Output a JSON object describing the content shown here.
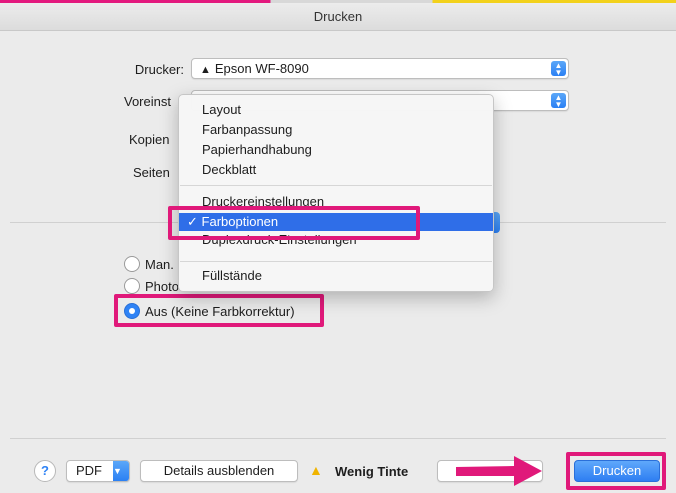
{
  "window": {
    "title": "Drucken"
  },
  "printer": {
    "label": "Drucker:",
    "value": "Epson WF-8090",
    "warning_icon": "warning-triangle-icon"
  },
  "presets": {
    "label_partial": "Voreinst"
  },
  "copies": {
    "label_partial": "Kopien"
  },
  "pages": {
    "label_partial": "Seiten"
  },
  "menu": {
    "items": [
      {
        "label": "Layout"
      },
      {
        "label": "Farbanpassung"
      },
      {
        "label": "Papierhandhabung"
      },
      {
        "label": "Deckblatt"
      },
      {
        "label": "Druckereinstellungen"
      },
      {
        "label": "Farboptionen",
        "checked": true,
        "check_glyph": "✓"
      },
      {
        "label": "Duplexdruck-Einstellungen"
      },
      {
        "label": "Füllstände"
      }
    ]
  },
  "color_options": {
    "radios": [
      {
        "label": "Man.",
        "selected": false
      },
      {
        "label": "Photo",
        "selected": false
      },
      {
        "label": "Aus (Keine Farbkorrektur)",
        "selected": true
      }
    ]
  },
  "footer": {
    "help": "?",
    "pdf_label": "PDF",
    "details_label": "Details ausblenden",
    "low_ink_label": "Wenig Tinte",
    "print_label": "Drucken"
  },
  "colors": {
    "highlight": "#e0197a",
    "accent_blue": "#2f6ee8",
    "warning_yellow": "#f0b400"
  }
}
